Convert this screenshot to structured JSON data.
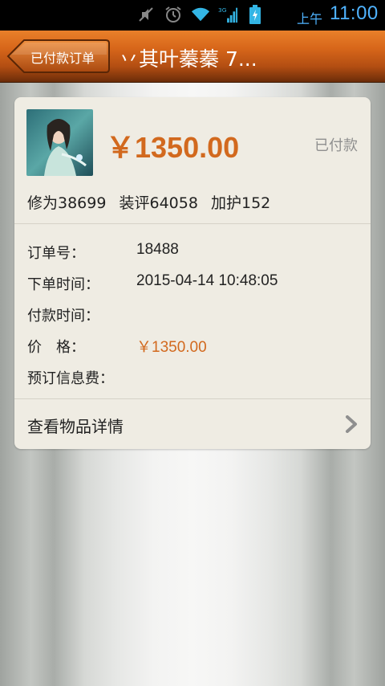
{
  "status_bar": {
    "ampm": "上午",
    "time": "11:00",
    "icons": [
      "mute-icon",
      "alarm-icon",
      "wifi-icon",
      "signal-3g-icon",
      "battery-charging-icon"
    ],
    "network": "3G"
  },
  "header": {
    "back_label": "已付款订单",
    "title": "丷其叶蓁蓁 7..."
  },
  "order": {
    "price_big": "￥1350.00",
    "status": "已付款",
    "stats": {
      "xiuwei": "修为38699",
      "zhuangping": "装评64058",
      "jiahu": "加护152"
    },
    "rows": [
      {
        "label": "订单号：",
        "value": "18488"
      },
      {
        "label": "下单时间：",
        "value": "2015-04-14 10:48:05"
      },
      {
        "label": "付款时间：",
        "value": ""
      },
      {
        "label": "价　格：",
        "value": "￥1350.00"
      },
      {
        "label": "预订信息费：",
        "value": ""
      }
    ],
    "details_link": "查看物品详情"
  },
  "colors": {
    "accent_orange": "#d2691e",
    "header_orange": "#e9802a",
    "card_bg": "#efece3",
    "status_blue": "#4fb3ff"
  }
}
